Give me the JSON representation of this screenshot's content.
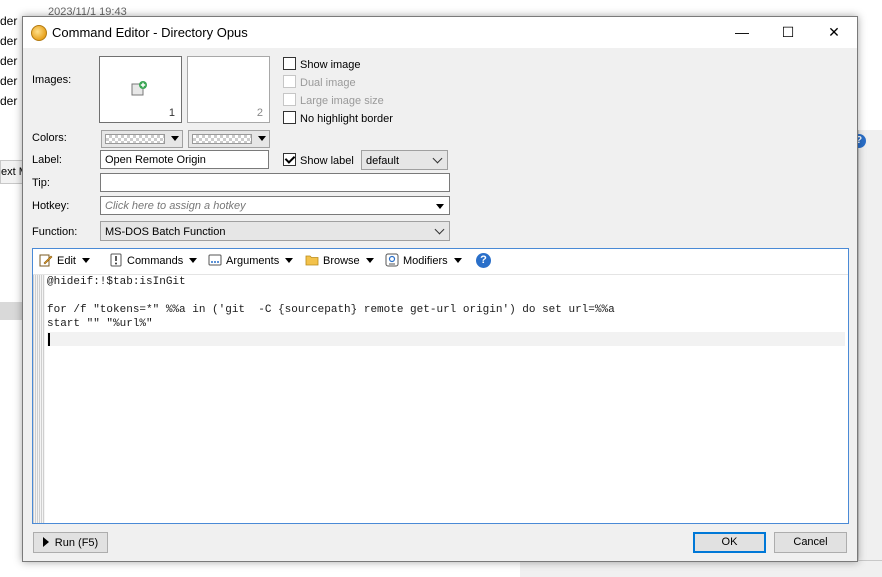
{
  "background": {
    "list_rows": [
      "der",
      "der",
      "der",
      "der",
      "der"
    ],
    "timestamp": "2023/11/1  19:43",
    "tab_label": "ext M",
    "help_glyph": "?"
  },
  "window": {
    "title": "Command Editor - Directory Opus",
    "minimize_glyph": "—",
    "maximize_glyph": "☐",
    "close_glyph": "✕"
  },
  "images": {
    "label": "Images:",
    "slot1_number": "1",
    "slot2_number": "2",
    "add_icon": "add-image-icon"
  },
  "options": {
    "show_image": {
      "label": "Show image",
      "checked": false,
      "enabled": true
    },
    "dual_image": {
      "label": "Dual image",
      "checked": false,
      "enabled": false
    },
    "large_image_size": {
      "label": "Large image size",
      "checked": false,
      "enabled": false
    },
    "no_highlight_border": {
      "label": "No highlight border",
      "checked": false,
      "enabled": true
    }
  },
  "colors": {
    "label": "Colors:"
  },
  "label_field": {
    "label": "Label:",
    "value": "Open Remote Origin",
    "show_label": {
      "label": "Show label",
      "checked": true
    },
    "style_value": "default"
  },
  "tip_field": {
    "label": "Tip:",
    "value": ""
  },
  "hotkey_field": {
    "label": "Hotkey:",
    "placeholder": "Click here to assign a hotkey"
  },
  "function_field": {
    "label": "Function:",
    "value": "MS-DOS Batch Function"
  },
  "editor_toolbar": {
    "edit": "Edit",
    "commands": "Commands",
    "arguments": "Arguments",
    "browse": "Browse",
    "modifiers": "Modifiers",
    "help": "?"
  },
  "code_lines": [
    "@hideif:!$tab:isInGit",
    "",
    "for /f \"tokens=*\" %%a in ('git  -C {sourcepath} remote get-url origin') do set url=%%a",
    "start \"\" \"%url%\""
  ],
  "buttons": {
    "run": "Run (F5)",
    "ok": "OK",
    "cancel": "Cancel"
  },
  "colors_accent": {
    "focus_border": "#4a8ad6",
    "help_blue": "#2a6fc9",
    "default_button": "#0078d7"
  }
}
